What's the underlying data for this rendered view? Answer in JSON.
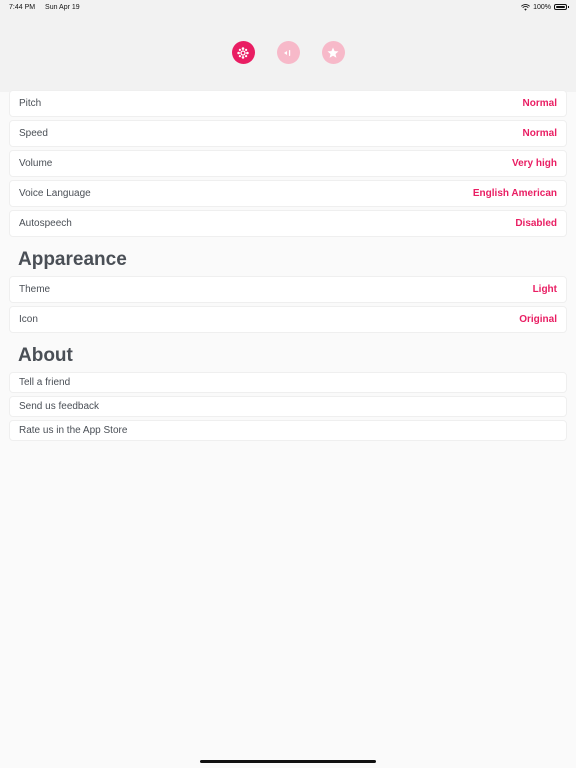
{
  "status_bar": {
    "time": "7:44 PM",
    "date": "Sun Apr 19",
    "battery": "100%"
  },
  "tabs": [
    {
      "icon": "settings-gear-icon",
      "active": true
    },
    {
      "icon": "speaker-icon",
      "active": false
    },
    {
      "icon": "star-icon",
      "active": false
    }
  ],
  "speech_settings": [
    {
      "label": "Pitch",
      "value": "Normal"
    },
    {
      "label": "Speed",
      "value": "Normal"
    },
    {
      "label": "Volume",
      "value": "Very high"
    },
    {
      "label": "Voice Language",
      "value": "English American"
    },
    {
      "label": "Autospeech",
      "value": "Disabled"
    }
  ],
  "appearance": {
    "title": "Appareance",
    "items": [
      {
        "label": "Theme",
        "value": "Light"
      },
      {
        "label": "Icon",
        "value": "Original"
      }
    ]
  },
  "about": {
    "title": "About",
    "items": [
      {
        "label": "Tell a friend"
      },
      {
        "label": "Send us feedback"
      },
      {
        "label": "Rate us in the App Store"
      }
    ]
  },
  "colors": {
    "accent": "#e91e63",
    "accent_light": "#f7b9c9",
    "background": "#fafafa"
  }
}
